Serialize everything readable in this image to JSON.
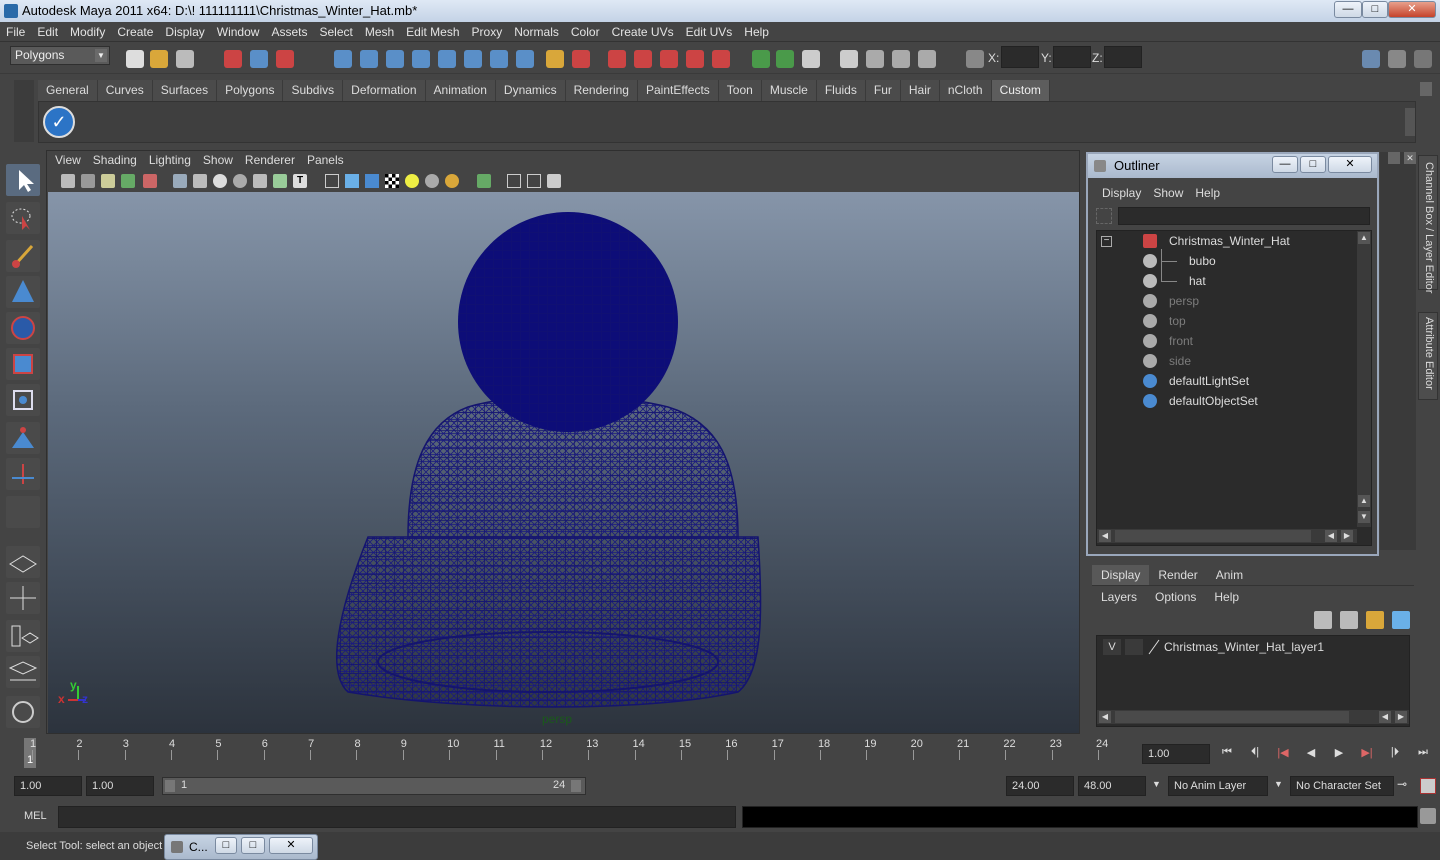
{
  "window": {
    "title": "Autodesk Maya 2011 x64: D:\\! 111111111\\Christmas_Winter_Hat.mb*",
    "minimize": "—",
    "maximize": "□",
    "close": "✕"
  },
  "menubar": [
    "File",
    "Edit",
    "Modify",
    "Create",
    "Display",
    "Window",
    "Assets",
    "Select",
    "Mesh",
    "Edit Mesh",
    "Proxy",
    "Normals",
    "Color",
    "Create UVs",
    "Edit UVs",
    "Help"
  ],
  "statusline": {
    "mode": "Polygons",
    "x_label": "X:",
    "y_label": "Y:",
    "z_label": "Z:"
  },
  "shelf_tabs": [
    "General",
    "Curves",
    "Surfaces",
    "Polygons",
    "Subdivs",
    "Deformation",
    "Animation",
    "Dynamics",
    "Rendering",
    "PaintEffects",
    "Toon",
    "Muscle",
    "Fluids",
    "Fur",
    "Hair",
    "nCloth",
    "Custom"
  ],
  "shelf_active": "Custom",
  "viewport": {
    "menu": [
      "View",
      "Shading",
      "Lighting",
      "Show",
      "Renderer",
      "Panels"
    ],
    "camera_label": "persp",
    "axis_x": "x",
    "axis_y": "y",
    "axis_z": "z",
    "wire_color": "#1a1a80"
  },
  "outliner": {
    "title": "Outliner",
    "menu": [
      "Display",
      "Show",
      "Help"
    ],
    "items": [
      {
        "label": "Christmas_Winter_Hat",
        "icon": "group-icon",
        "dim": false
      },
      {
        "label": "bubo",
        "icon": "mesh-icon",
        "dim": false
      },
      {
        "label": "hat",
        "icon": "mesh-icon",
        "dim": false
      },
      {
        "label": "persp",
        "icon": "camera-icon",
        "dim": true
      },
      {
        "label": "top",
        "icon": "camera-icon",
        "dim": true
      },
      {
        "label": "front",
        "icon": "camera-icon",
        "dim": true
      },
      {
        "label": "side",
        "icon": "camera-icon",
        "dim": true
      },
      {
        "label": "defaultLightSet",
        "icon": "set-icon",
        "dim": false
      },
      {
        "label": "defaultObjectSet",
        "icon": "set-icon",
        "dim": false
      }
    ]
  },
  "side_tabs": {
    "channel_box": "Channel Box / Layer Editor",
    "attribute_editor": "Attribute Editor"
  },
  "layer_editor": {
    "tabs": [
      "Display",
      "Render",
      "Anim"
    ],
    "menu": [
      "Layers",
      "Options",
      "Help"
    ],
    "layer": {
      "visible": "V",
      "name": "Christmas_Winter_Hat_layer1"
    }
  },
  "timeline": {
    "ticks": [
      "1",
      "2",
      "3",
      "4",
      "5",
      "6",
      "7",
      "8",
      "9",
      "10",
      "11",
      "12",
      "13",
      "14",
      "15",
      "16",
      "17",
      "18",
      "19",
      "20",
      "21",
      "22",
      "23",
      "24"
    ],
    "current_frame": "1.00",
    "current_marker": "1"
  },
  "range": {
    "start": "1.00",
    "playback_start": "1.00",
    "slider_start": "1",
    "slider_end": "24",
    "playback_end": "24.00",
    "end": "48.00",
    "anim_layer": "No Anim Layer",
    "character_set": "No Character Set"
  },
  "command": {
    "label": "MEL"
  },
  "helpline": {
    "text": "Select Tool: select an object",
    "minimized_window": "C..."
  }
}
